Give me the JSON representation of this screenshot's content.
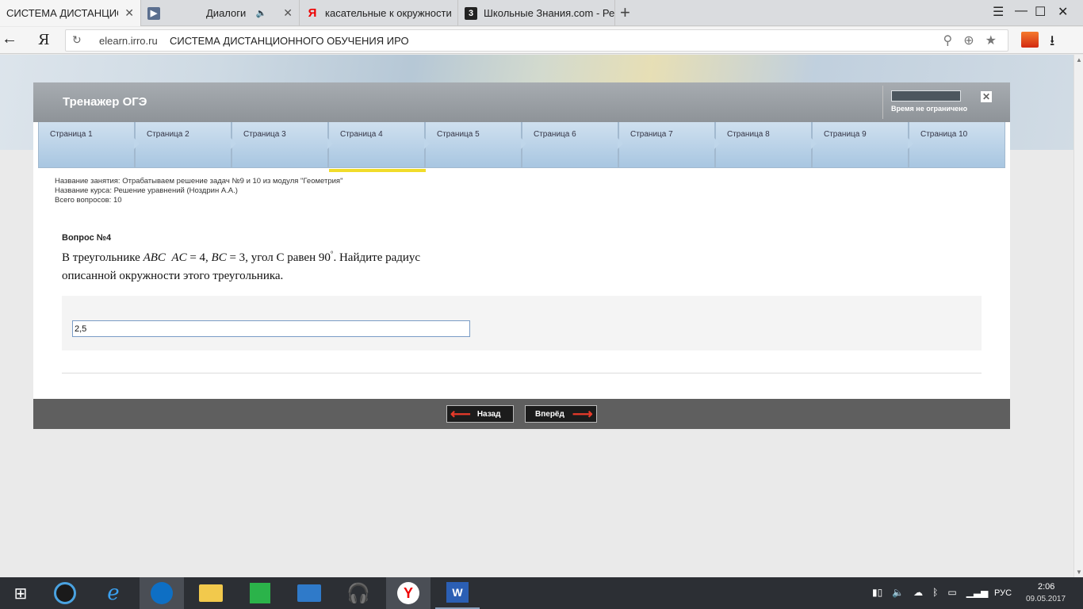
{
  "browser": {
    "tabs": [
      {
        "title": "СИСТЕМА ДИСТАНЦИОНН",
        "icon": "none",
        "active": true,
        "close": "✕"
      },
      {
        "title": "Диалоги",
        "icon": "play-icon",
        "audio": "🔈",
        "close": "✕"
      },
      {
        "title": "касательные к окружности",
        "icon": "yandex-icon",
        "close": "✕"
      },
      {
        "title": "Школьные Знания.com - Ре",
        "icon": "znanija-icon"
      }
    ],
    "new_tab": "+",
    "window_buttons": {
      "menu": "☰",
      "minimize": "—",
      "maximize": "☐",
      "close": "✕"
    },
    "back": "←",
    "yandex_logo": "Я",
    "reload": "↻",
    "domain": "elearn.irro.ru",
    "page_title": "СИСТЕМА ДИСТАНЦИОННОГО ОБУЧЕНИЯ ИРО",
    "url_icons": {
      "search": "⚲",
      "protect": "⊕",
      "bookmark": "★"
    },
    "download": "⭳"
  },
  "trainer": {
    "title": "Тренажер ОГЭ",
    "timer_text": "Время не ограничено",
    "close": "✕",
    "pages": [
      "Страница 1",
      "Страница 2",
      "Страница 3",
      "Страница 4",
      "Страница 5",
      "Страница 6",
      "Страница 7",
      "Страница 8",
      "Страница 9",
      "Страница 10"
    ],
    "current_page_index": 3,
    "lesson_name": "Название занятия: Отрабатываем решение задач №9 и 10 из модуля \"Геометрия\"",
    "course_name": "Название курса: Решение уравнений (Ноздрин А.А.)",
    "total_questions": "Всего вопросов: 10",
    "question_no": "Вопрос №4",
    "question": {
      "p1": "В треугольнике ",
      "abc": "ABC",
      "ac": "AC",
      "ac_val": " = 4, ",
      "bc": "BC",
      "bc_val": " = 3",
      "p2": ", угол С равен 90",
      "deg": "°",
      "p3": ". Найдите радиус описанной окружности этого треугольника."
    },
    "answer_value": "2,5",
    "back_label": "Назад",
    "next_label": "Вперёд",
    "arrow_left": "⟵",
    "arrow_right": "⟶"
  },
  "taskbar": {
    "start": "⊞",
    "apps": [
      "teamviewer-viewer-icon",
      "internet-explorer-icon",
      "teamviewer-icon",
      "file-explorer-icon",
      "store-icon",
      "lenovo-icon",
      "headphones-icon",
      "yandex-browser-icon",
      "word-icon"
    ],
    "lang": "РУС",
    "time": "2:06",
    "date": "09.05.2017"
  }
}
